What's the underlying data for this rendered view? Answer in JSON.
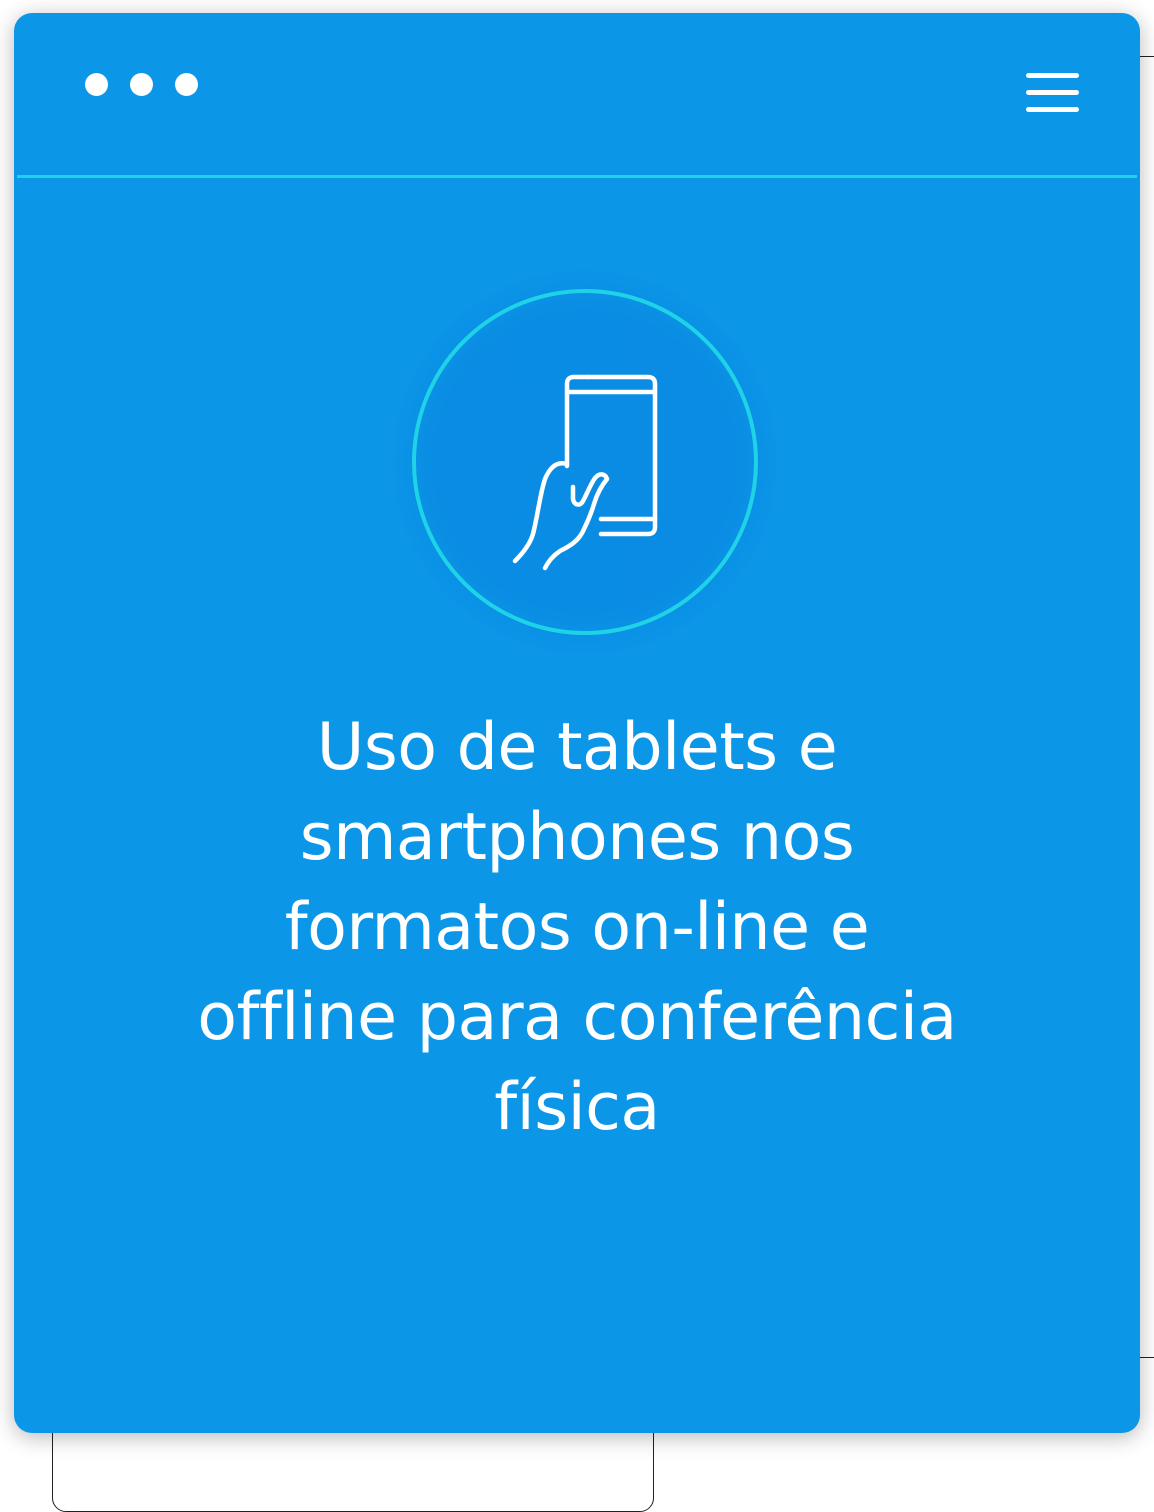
{
  "colors": {
    "card_background": "#0B96E8",
    "accent": "#1FD3E6",
    "text": "#FFFFFF"
  },
  "header": {
    "window_dots": [
      "dot",
      "dot",
      "dot"
    ],
    "menu_icon": "hamburger-menu-icon"
  },
  "feature": {
    "icon": "hand-holding-smartphone-icon",
    "title": "Uso de tablets e smartphones nos formatos on-line e offline para conferência física"
  }
}
